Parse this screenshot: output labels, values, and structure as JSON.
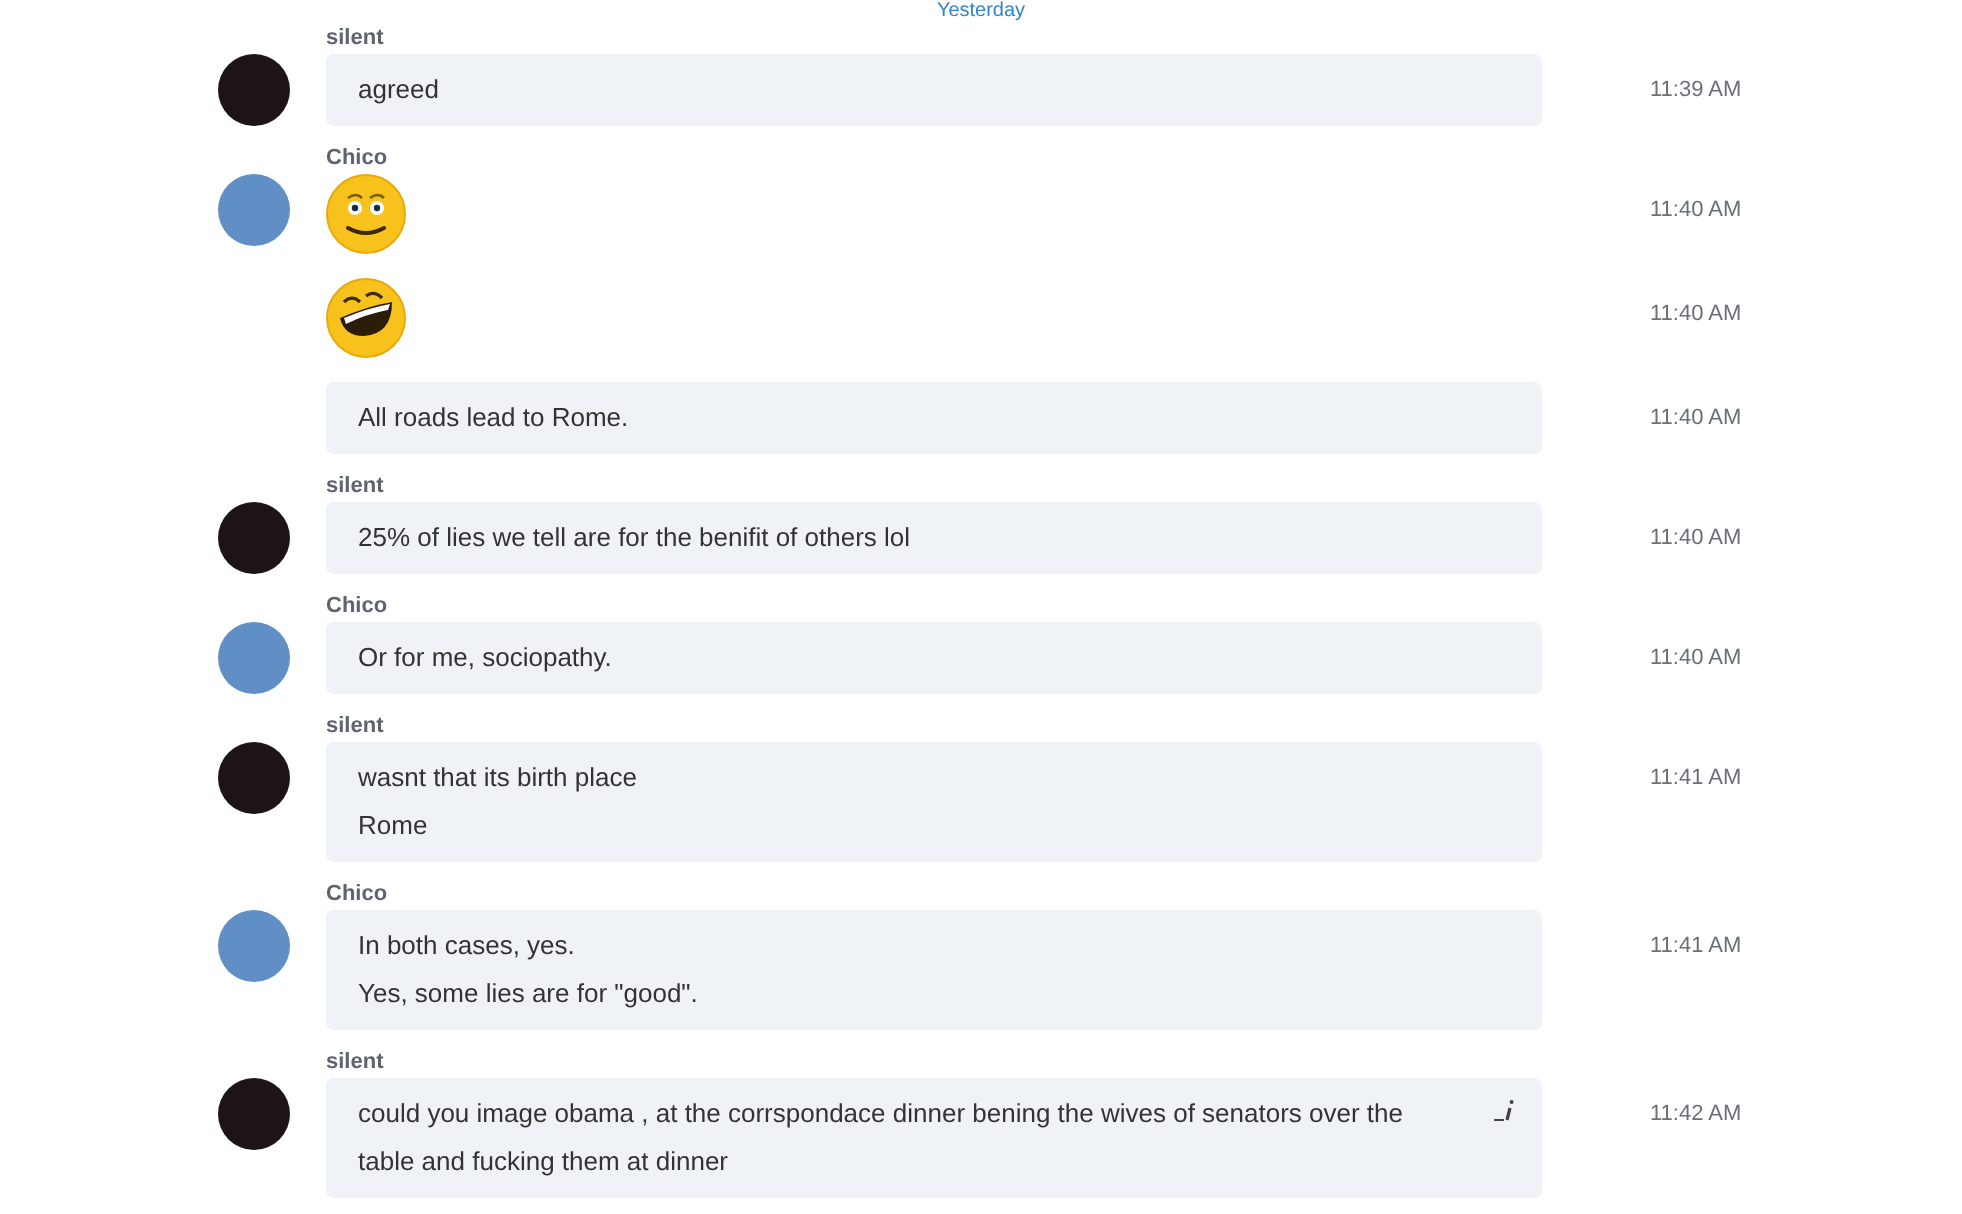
{
  "date_divider": "Yesterday",
  "groups": [
    {
      "sender": "silent",
      "color": "#1c1416",
      "items": [
        {
          "kind": "text",
          "lines": [
            "agreed"
          ],
          "time": "11:39 AM",
          "edited": false
        }
      ]
    },
    {
      "sender": "Chico",
      "color": "#5f8fc4",
      "items": [
        {
          "kind": "smile",
          "time": "11:40 AM"
        },
        {
          "kind": "laugh",
          "time": "11:40 AM"
        },
        {
          "kind": "text",
          "lines": [
            "All roads lead to Rome."
          ],
          "time": "11:40 AM",
          "edited": false
        }
      ]
    },
    {
      "sender": "silent",
      "color": "#1c1416",
      "items": [
        {
          "kind": "text",
          "lines": [
            "25% of lies we tell are for the benifit of others lol"
          ],
          "time": "11:40 AM",
          "edited": false
        }
      ]
    },
    {
      "sender": "Chico",
      "color": "#5f8fc4",
      "items": [
        {
          "kind": "text",
          "lines": [
            "Or for me, sociopathy."
          ],
          "time": "11:40 AM",
          "edited": false
        }
      ]
    },
    {
      "sender": "silent",
      "color": "#1c1416",
      "items": [
        {
          "kind": "text",
          "lines": [
            "wasnt that its birth place",
            "Rome"
          ],
          "time": "11:41 AM",
          "edited": false
        }
      ]
    },
    {
      "sender": "Chico",
      "color": "#5f8fc4",
      "items": [
        {
          "kind": "text",
          "lines": [
            "In both cases, yes.",
            "Yes, some lies are for \"good\"."
          ],
          "time": "11:41 AM",
          "edited": false
        }
      ]
    },
    {
      "sender": "silent",
      "color": "#1c1416",
      "items": [
        {
          "kind": "text",
          "lines": [
            "could you image obama  , at the corrspondace dinner bening the wives of senators over the table and fucking them at dinner"
          ],
          "time": "11:42 AM",
          "edited": true
        }
      ]
    }
  ]
}
